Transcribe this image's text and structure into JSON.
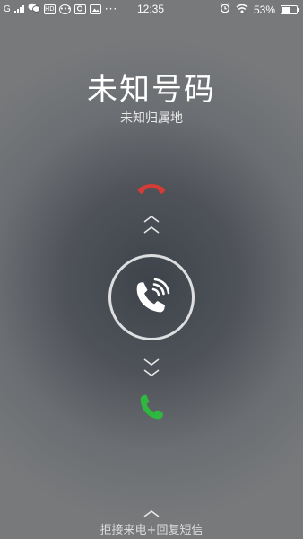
{
  "status_bar": {
    "carrier": "G",
    "time": "12:35",
    "battery_percent": "53%",
    "battery_level": 0.53,
    "notification_icons": [
      "wechat-icon",
      "hd-icon",
      "chat-bubble-icon",
      "search-app-icon",
      "image-app-icon",
      "more-dots-icon"
    ],
    "right_icons": [
      "alarm-icon",
      "wifi-icon",
      "battery-icon"
    ]
  },
  "call": {
    "caller_name": "未知号码",
    "caller_location": "未知归属地"
  },
  "actions": {
    "decline_icon": "decline-call-icon",
    "answer_icon": "phone-ringing-icon",
    "accept_icon": "accept-call-icon",
    "reject_sms_label": "拒接来电+回复短信"
  },
  "colors": {
    "decline": "#d63c35",
    "accept": "#2fb83f",
    "background": "#5a5e63"
  }
}
